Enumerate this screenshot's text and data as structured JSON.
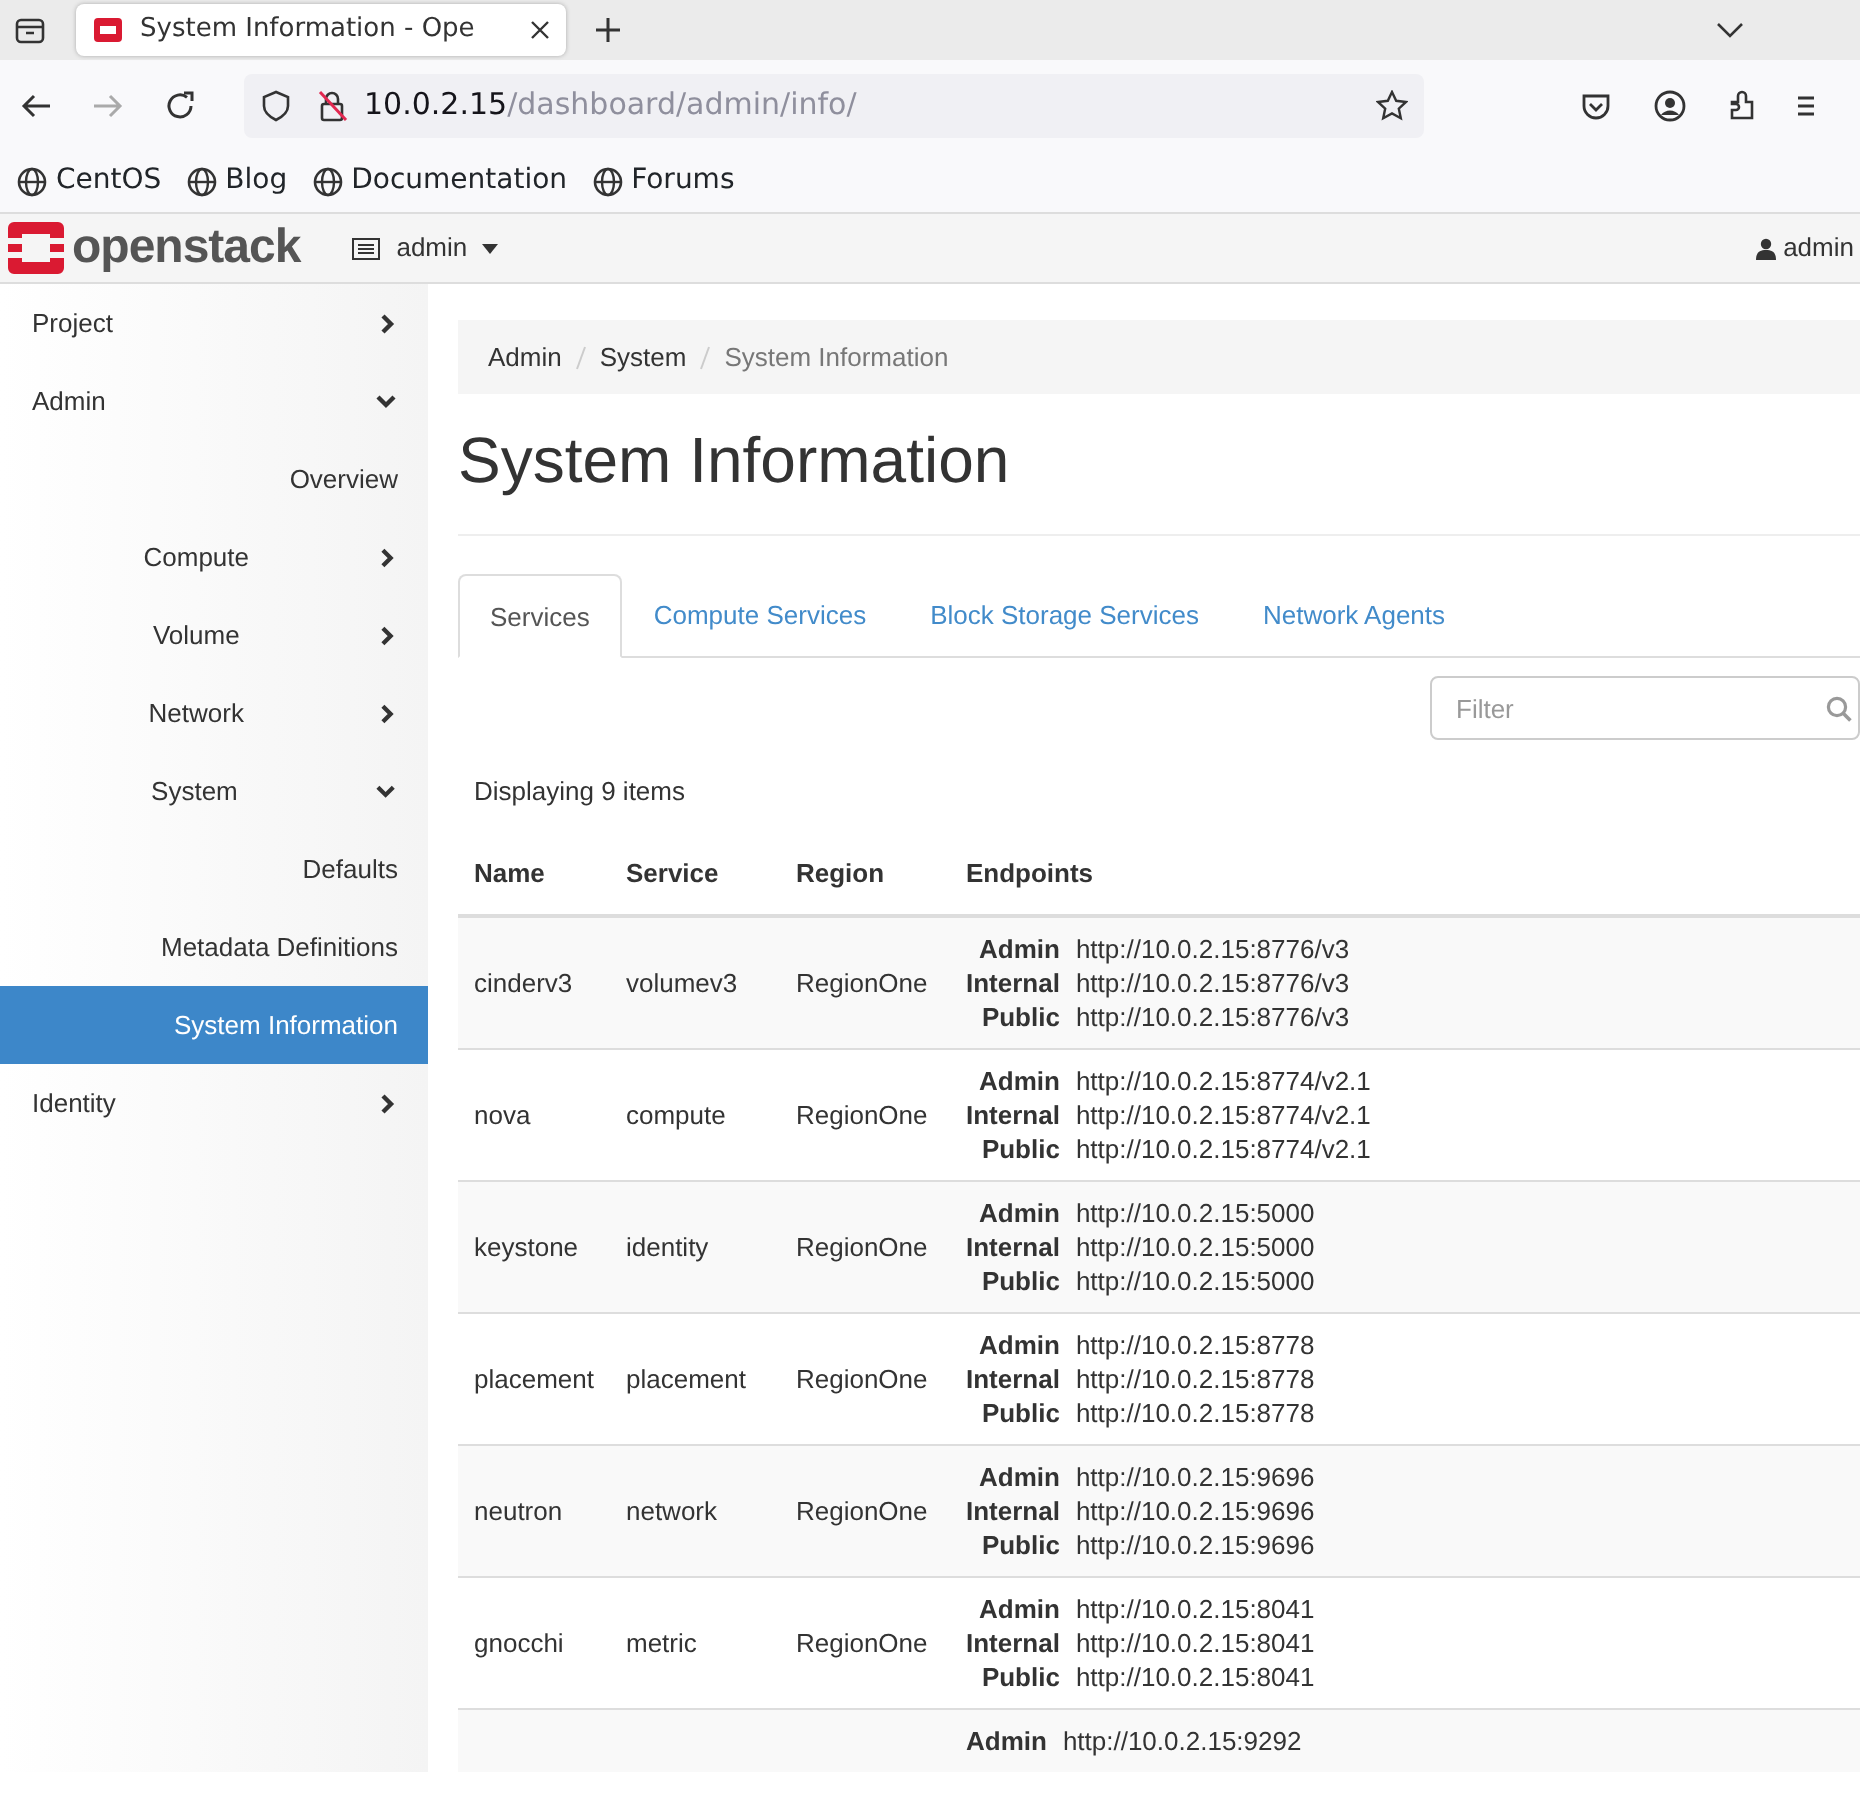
{
  "browser": {
    "tab_title": "System Information - Ope",
    "url_host": "10.0.2.15",
    "url_path": "/dashboard/admin/info/",
    "bookmarks": [
      "CentOS",
      "Blog",
      "Documentation",
      "Forums"
    ]
  },
  "header": {
    "logo": "openstack",
    "project_menu": "admin",
    "user_menu": "admin"
  },
  "sidebar": {
    "items": [
      {
        "label": "Project",
        "expanded": false
      },
      {
        "label": "Admin",
        "expanded": true,
        "children": [
          {
            "label": "Overview",
            "selected": false
          },
          {
            "label": "Compute",
            "expanded": false
          },
          {
            "label": "Volume",
            "expanded": false
          },
          {
            "label": "Network",
            "expanded": false
          },
          {
            "label": "System",
            "expanded": true,
            "children": [
              {
                "label": "Defaults",
                "selected": false
              },
              {
                "label": "Metadata Definitions",
                "selected": false
              },
              {
                "label": "System Information",
                "selected": true
              }
            ]
          }
        ]
      },
      {
        "label": "Identity",
        "expanded": false
      }
    ]
  },
  "breadcrumb": [
    "Admin",
    "System",
    "System Information"
  ],
  "title": "System Information",
  "tabs": [
    {
      "label": "Services",
      "selected": true
    },
    {
      "label": "Compute Services",
      "selected": false
    },
    {
      "label": "Block Storage Services",
      "selected": false
    },
    {
      "label": "Network Agents",
      "selected": false
    }
  ],
  "filter": {
    "placeholder": "Filter"
  },
  "table": {
    "count": "Displaying 9 items",
    "columns": [
      "Name",
      "Service",
      "Region",
      "Endpoints"
    ],
    "rows": [
      {
        "name": "cinderv3",
        "service": "volumev3",
        "region": "RegionOne",
        "endpoints": [
          {
            "label": "Admin",
            "url": "http://10.0.2.15:8776/v3"
          },
          {
            "label": "Internal",
            "url": "http://10.0.2.15:8776/v3"
          },
          {
            "label": "Public",
            "url": "http://10.0.2.15:8776/v3"
          }
        ]
      },
      {
        "name": "nova",
        "service": "compute",
        "region": "RegionOne",
        "endpoints": [
          {
            "label": "Admin",
            "url": "http://10.0.2.15:8774/v2.1"
          },
          {
            "label": "Internal",
            "url": "http://10.0.2.15:8774/v2.1"
          },
          {
            "label": "Public",
            "url": "http://10.0.2.15:8774/v2.1"
          }
        ]
      },
      {
        "name": "keystone",
        "service": "identity",
        "region": "RegionOne",
        "endpoints": [
          {
            "label": "Admin",
            "url": "http://10.0.2.15:5000"
          },
          {
            "label": "Internal",
            "url": "http://10.0.2.15:5000"
          },
          {
            "label": "Public",
            "url": "http://10.0.2.15:5000"
          }
        ]
      },
      {
        "name": "placement",
        "service": "placement",
        "region": "RegionOne",
        "endpoints": [
          {
            "label": "Admin",
            "url": "http://10.0.2.15:8778"
          },
          {
            "label": "Internal",
            "url": "http://10.0.2.15:8778"
          },
          {
            "label": "Public",
            "url": "http://10.0.2.15:8778"
          }
        ]
      },
      {
        "name": "neutron",
        "service": "network",
        "region": "RegionOne",
        "endpoints": [
          {
            "label": "Admin",
            "url": "http://10.0.2.15:9696"
          },
          {
            "label": "Internal",
            "url": "http://10.0.2.15:9696"
          },
          {
            "label": "Public",
            "url": "http://10.0.2.15:9696"
          }
        ]
      },
      {
        "name": "gnocchi",
        "service": "metric",
        "region": "RegionOne",
        "endpoints": [
          {
            "label": "Admin",
            "url": "http://10.0.2.15:8041"
          },
          {
            "label": "Internal",
            "url": "http://10.0.2.15:8041"
          },
          {
            "label": "Public",
            "url": "http://10.0.2.15:8041"
          }
        ]
      },
      {
        "endpoints": [
          {
            "label": "Admin",
            "url": "http://10.0.2.15:9292"
          }
        ]
      }
    ]
  }
}
